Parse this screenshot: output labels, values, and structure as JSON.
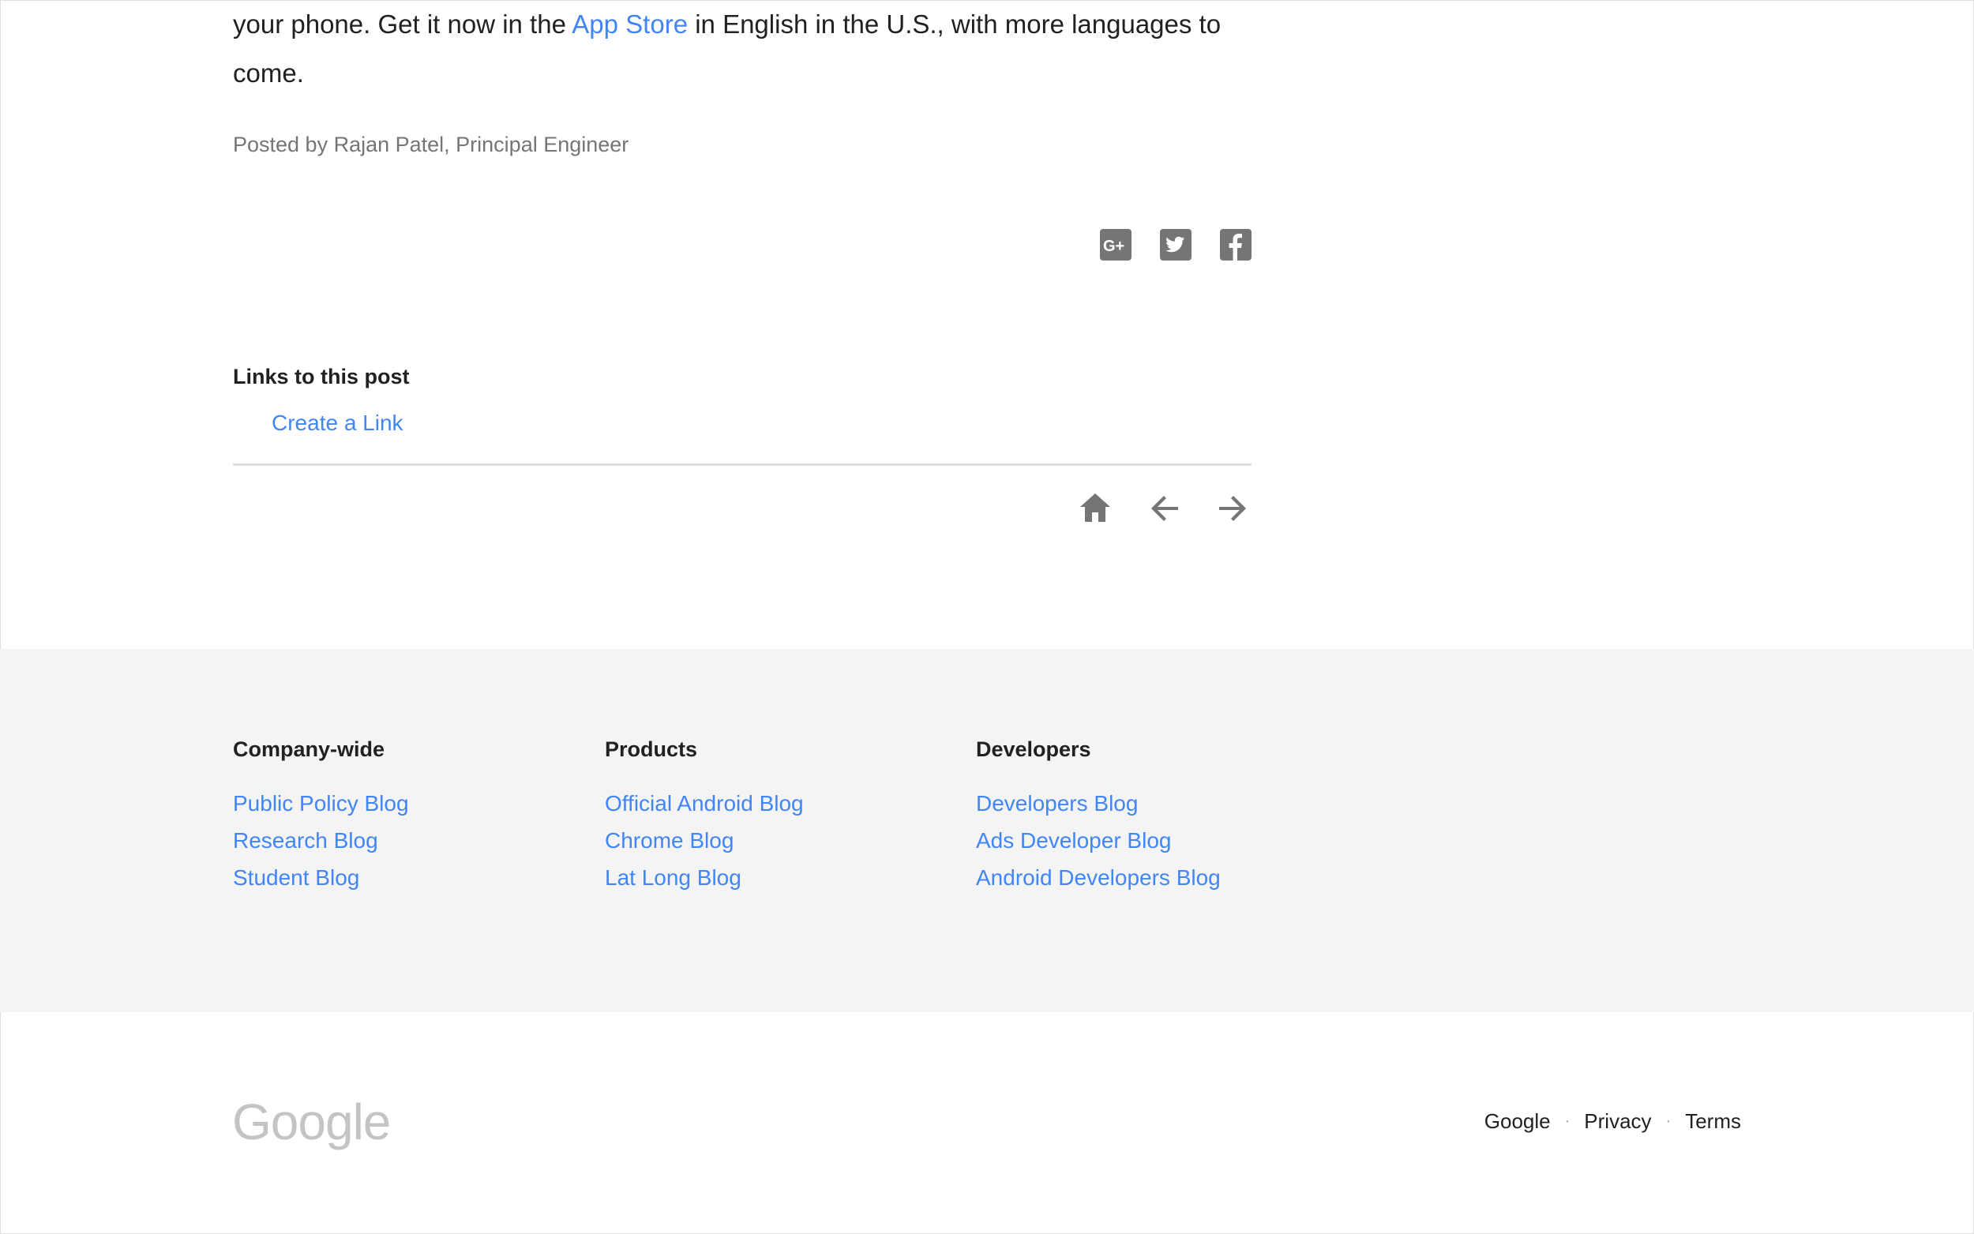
{
  "article": {
    "line1_before_link": "your phone. Get it now in the ",
    "line1_link": "App Store",
    "line1_after_link": " in English in the U.S., with more languages to",
    "line2": "come.",
    "byline": "Posted by Rajan Patel, Principal Engineer"
  },
  "share": {
    "icons": [
      "google-plus-icon",
      "twitter-icon",
      "facebook-icon"
    ]
  },
  "links_section": {
    "heading": "Links to this post",
    "create_link": "Create a Link"
  },
  "post_nav": {
    "icons": [
      "home-icon",
      "arrow-left-icon",
      "arrow-right-icon"
    ]
  },
  "footer": {
    "columns": [
      {
        "heading": "Company-wide",
        "links": [
          "Public Policy Blog",
          "Research Blog",
          "Student Blog"
        ]
      },
      {
        "heading": "Products",
        "links": [
          "Official Android Blog",
          "Chrome Blog",
          "Lat Long Blog"
        ]
      },
      {
        "heading": "Developers",
        "links": [
          "Developers Blog",
          "Ads Developer Blog",
          "Android Developers Blog"
        ]
      }
    ],
    "logo": "Google",
    "bottom_links": [
      "Google",
      "Privacy",
      "Terms"
    ]
  },
  "colors": {
    "link": "#4285f4",
    "icon_gray": "#757575",
    "footer_bg": "#f4f4f4"
  }
}
